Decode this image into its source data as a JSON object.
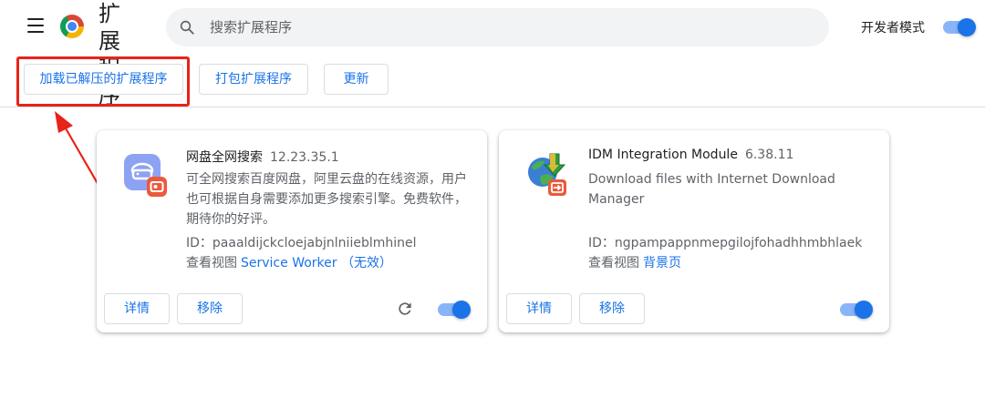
{
  "header": {
    "title": "扩展程序",
    "search_placeholder": "搜索扩展程序",
    "dev_mode_label": "开发者模式",
    "dev_mode_on": true
  },
  "toolbar": {
    "load_unpacked": "加载已解压的扩展程序",
    "pack": "打包扩展程序",
    "update": "更新"
  },
  "extensions": [
    {
      "name": "网盘全网搜索",
      "version": "12.23.35.1",
      "description": "可全网搜索百度网盘，阿里云盘的在线资源，用户也可根据自身需要添加更多搜索引擎。免费软件，期待你的好评。",
      "id_label": "ID：",
      "id": "paaaldijckcloejabjnlniieblmhinel",
      "views_label": "查看视图",
      "view_link": "Service Worker （无效）",
      "details": "详情",
      "remove": "移除",
      "enabled": true,
      "icon": "cloud-drive-icon"
    },
    {
      "name": "IDM Integration Module",
      "version": "6.38.11",
      "description": "Download files with Internet Download Manager",
      "id_label": "ID：",
      "id": "ngpampappnmepgilojfohadhhmbhlaek",
      "views_label": "查看视图",
      "view_link": "背景页",
      "details": "详情",
      "remove": "移除",
      "enabled": true,
      "icon": "idm-globe-icon"
    }
  ],
  "colors": {
    "accent": "#1a73e8",
    "annotation": "#e8231a"
  }
}
